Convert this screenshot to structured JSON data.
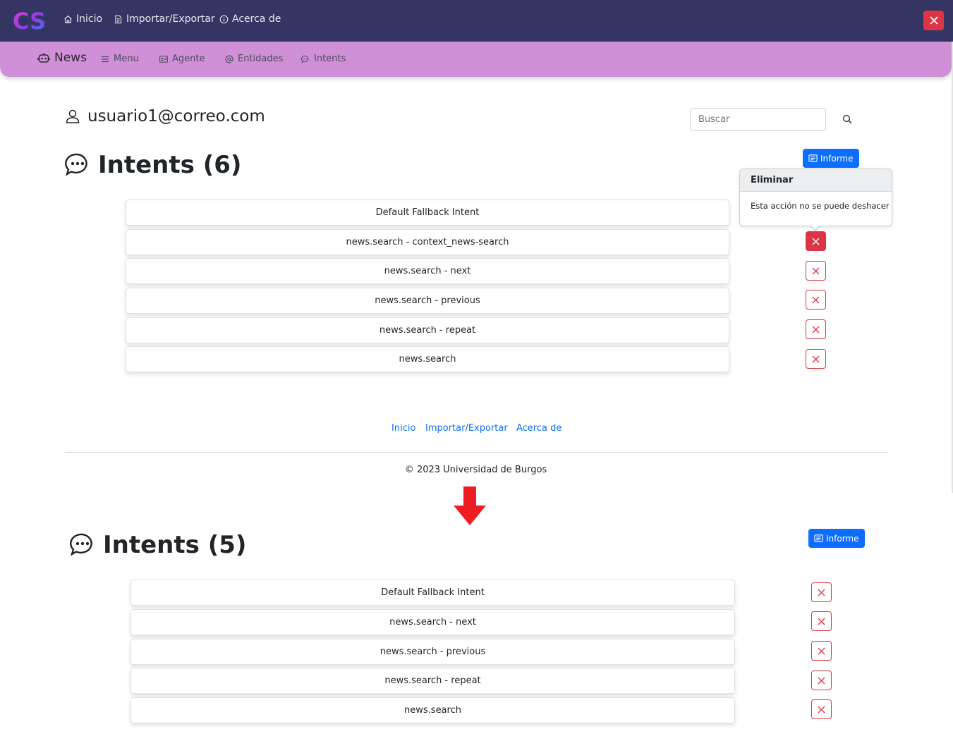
{
  "topbar": {
    "logo_text": "CS",
    "links": [
      "Inicio",
      "Importar/Exportar",
      "Acerca de"
    ],
    "close_icon": "close-icon"
  },
  "subbar": {
    "brand": "News",
    "links": [
      "Menu",
      "Agente",
      "Entidades",
      "Intents"
    ]
  },
  "user": {
    "email": "usuario1@correo.com"
  },
  "search": {
    "placeholder": "Buscar"
  },
  "before": {
    "title": "Intents (6)",
    "informe_label": "Informe",
    "intents": [
      "Default Fallback Intent",
      "news.search - context_news-search",
      "news.search - next",
      "news.search - previous",
      "news.search - repeat",
      "news.search"
    ],
    "popover": {
      "title": "Eliminar",
      "body": "Esta acción no se puede deshacer"
    }
  },
  "footer": {
    "links": [
      "Inicio",
      "Importar/Exportar",
      "Acerca de"
    ],
    "copyright": "© 2023 Universidad de Burgos"
  },
  "after": {
    "title": "Intents (5)",
    "informe_label": "Informe",
    "intents": [
      "Default Fallback Intent",
      "news.search - next",
      "news.search - previous",
      "news.search - repeat",
      "news.search"
    ]
  },
  "colors": {
    "topbar": "#353563",
    "subbar": "#cf90d8",
    "primary": "#0d6efd",
    "danger": "#dc3545"
  }
}
